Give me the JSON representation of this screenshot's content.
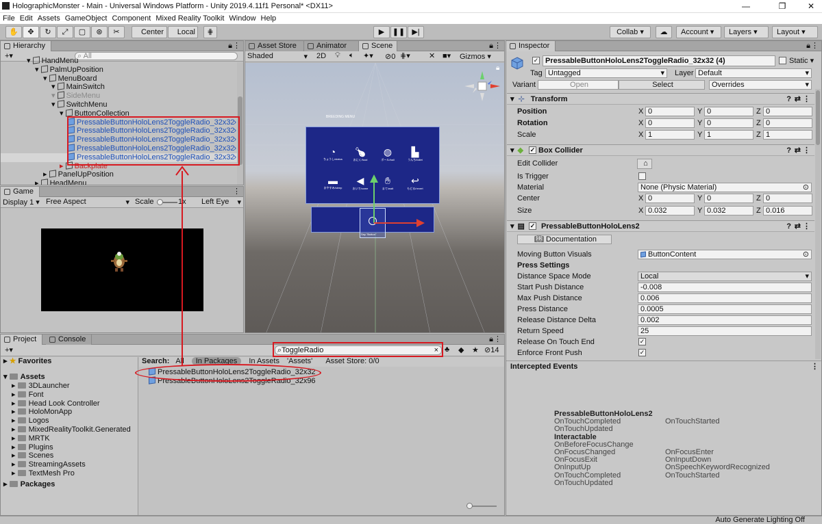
{
  "window": {
    "title": "HolographicMonster - Main - Universal Windows Platform - Unity 2019.4.11f1 Personal* <DX11>",
    "controls": [
      "—",
      "❐",
      "✕"
    ]
  },
  "menu": [
    "File",
    "Edit",
    "Assets",
    "GameObject",
    "Component",
    "Mixed Reality Toolkit",
    "Window",
    "Help"
  ],
  "toolbar": {
    "pivot": "Center",
    "space": "Local",
    "collab": "Collab ▾",
    "account": "Account",
    "layers": "Layers",
    "layout": "Layout"
  },
  "hierarchy": {
    "tab": "Hierarchy",
    "search_placeholder": "All",
    "items": [
      {
        "label": "HandMenu",
        "indent": 3
      },
      {
        "label": "PalmUpPosition",
        "indent": 4
      },
      {
        "label": "MenuBoard",
        "indent": 5
      },
      {
        "label": "MainSwitch",
        "indent": 6
      },
      {
        "label": "SideMenu",
        "indent": 6,
        "dim": true
      },
      {
        "label": "SwitchMenu",
        "indent": 6
      },
      {
        "label": "ButtonCollection",
        "indent": 7
      },
      {
        "label": "PressableButtonHoloLens2ToggleRadio_32x32",
        "indent": 8,
        "prefab": true
      },
      {
        "label": "PressableButtonHoloLens2ToggleRadio_32x32",
        "indent": 8,
        "prefab": true
      },
      {
        "label": "PressableButtonHoloLens2ToggleRadio_32x32",
        "indent": 8,
        "prefab": true
      },
      {
        "label": "PressableButtonHoloLens2ToggleRadio_32x32",
        "indent": 8,
        "prefab": true
      },
      {
        "label": "PressableButtonHoloLens2ToggleRadio_32x32",
        "indent": 8,
        "prefab": true
      },
      {
        "label": "Backplate",
        "indent": 7,
        "red": true
      },
      {
        "label": "PanelUpPosition",
        "indent": 5
      },
      {
        "label": "HeadMenu",
        "indent": 4
      }
    ]
  },
  "game": {
    "tab": "Game",
    "display": "Display 1",
    "aspect": "Free Aspect",
    "scale_label": "Scale",
    "scale_value": "1x",
    "eye": "Left Eye"
  },
  "scene": {
    "tabs": [
      "Asset Store",
      "Animator",
      "Scene"
    ],
    "shading": "Shaded",
    "mode_2d": "2D",
    "gizmos": "Gizmos",
    "hidden_count": "0",
    "menu_title": "BREEDING MENU",
    "buttons": [
      {
        "label": "ちょうし/status",
        "icon": "gauge-icon"
      },
      {
        "label": "おにく/food",
        "icon": "meat-icon"
      },
      {
        "label": "ボール/ball",
        "icon": "ball-icon"
      },
      {
        "label": "うんち/toilet",
        "icon": "toilet-icon"
      },
      {
        "label": "おやすみ/sleep",
        "icon": "bed-icon"
      },
      {
        "label": "おいで/come",
        "icon": "megaphone-icon"
      },
      {
        "label": "まて/wait",
        "icon": "hand-icon"
      },
      {
        "label": "もどる/revert",
        "icon": "return-icon"
      }
    ],
    "say_label": "Say \"Button\""
  },
  "project": {
    "tabs": [
      "Project",
      "Console"
    ],
    "search_value": "ToggleRadio",
    "search_label": "Search:",
    "search_scopes": [
      "All",
      "In Packages",
      "In Assets",
      "'Assets'",
      "Asset Store: 0/0"
    ],
    "hidden_count": "14",
    "favorites": "Favorites",
    "assets_root": "Assets",
    "folders": [
      "3DLauncher",
      "Font",
      "Head Look Controller",
      "HoloMonApp",
      "Logos",
      "MixedRealityToolkit.Generated",
      "MRTK",
      "Plugins",
      "Scenes",
      "StreamingAssets",
      "TextMesh Pro"
    ],
    "packages": "Packages",
    "results": [
      "PressableButtonHoloLens2ToggleRadio_32x32",
      "PressableButtonHoloLens2ToggleRadio_32x96"
    ]
  },
  "inspector": {
    "tab": "Inspector",
    "object_name": "PressableButtonHoloLens2ToggleRadio_32x32 (4)",
    "static_label": "Static",
    "tag_label": "Tag",
    "tag": "Untagged",
    "layer_label": "Layer",
    "layer": "Default",
    "variant_label": "Variant",
    "open": "Open",
    "select": "Select",
    "overrides": "Overrides",
    "transform": {
      "title": "Transform",
      "rows": [
        {
          "label": "Position",
          "x": "0",
          "y": "0",
          "z": "0",
          "bold": true
        },
        {
          "label": "Rotation",
          "x": "0",
          "y": "0",
          "z": "0",
          "bold": true
        },
        {
          "label": "Scale",
          "x": "1",
          "y": "1",
          "z": "1",
          "bold": false
        }
      ]
    },
    "box_collider": {
      "title": "Box Collider",
      "edit_collider": "Edit Collider",
      "is_trigger": "Is Trigger",
      "material_label": "Material",
      "material": "None (Physic Material)",
      "center_label": "Center",
      "center": {
        "x": "0",
        "y": "0",
        "z": "0"
      },
      "size_label": "Size",
      "size": {
        "x": "0.032",
        "y": "0.032",
        "z": "0.016"
      }
    },
    "pressable": {
      "title": "PressableButtonHoloLens2",
      "documentation": "Documentation",
      "moving_visuals_label": "Moving Button Visuals",
      "moving_visuals": "ButtonContent",
      "press_settings": "Press Settings",
      "fields": [
        {
          "label": "Distance Space Mode",
          "value": "Local",
          "dropdown": true
        },
        {
          "label": "Start Push Distance",
          "value": "-0.008"
        },
        {
          "label": "Max Push Distance",
          "value": "0.006"
        },
        {
          "label": "Press Distance",
          "value": "0.0005"
        },
        {
          "label": "Release Distance Delta",
          "value": "0.002"
        },
        {
          "label": "Return Speed",
          "value": "25"
        },
        {
          "label": "Release On Touch End",
          "value": "✓",
          "check": true
        },
        {
          "label": "Enforce Front Push",
          "value": "✓",
          "check": true
        }
      ]
    },
    "intercepted_events": {
      "title": "Intercepted Events",
      "left": [
        "PressableButtonHoloLens2",
        "OnTouchCompleted",
        "OnTouchUpdated",
        "Interactable",
        "OnBeforeFocusChange",
        "OnFocusChanged",
        "OnFocusExit",
        "OnInputUp",
        "OnTouchCompleted",
        "OnTouchUpdated"
      ],
      "right": [
        "",
        "OnTouchStarted",
        "",
        "",
        "",
        "OnFocusEnter",
        "OnInputDown",
        "OnSpeechKeywordRecognized",
        "OnTouchStarted",
        ""
      ]
    }
  },
  "status_bar": "Auto Generate Lighting Off"
}
